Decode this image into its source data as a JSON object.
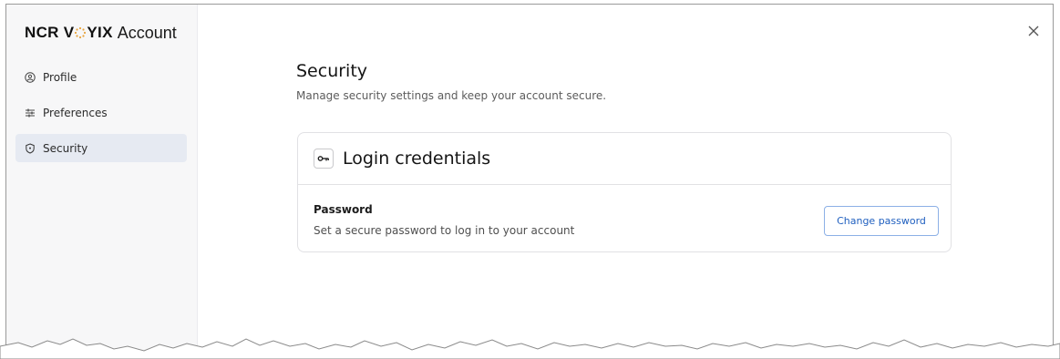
{
  "app": {
    "brand": "NCR VOYIX",
    "title": "Account"
  },
  "sidebar": {
    "items": [
      {
        "label": "Profile",
        "icon": "profile-icon",
        "active": false
      },
      {
        "label": "Preferences",
        "icon": "sliders-icon",
        "active": false
      },
      {
        "label": "Security",
        "icon": "shield-icon",
        "active": true
      }
    ]
  },
  "header": {
    "close_icon": "close-icon"
  },
  "main": {
    "title": "Security",
    "subtitle": "Manage security settings and keep your account secure."
  },
  "card": {
    "icon": "key-icon",
    "title": "Login credentials",
    "field_label": "Password",
    "field_description": "Set a secure password to log in to your account",
    "button_label": "Change password"
  },
  "colors": {
    "sidebar_bg": "#f7f7f8",
    "active_bg": "#e6eaf2",
    "accent": "#1f5fbf",
    "button_border": "#8cb0e6"
  }
}
